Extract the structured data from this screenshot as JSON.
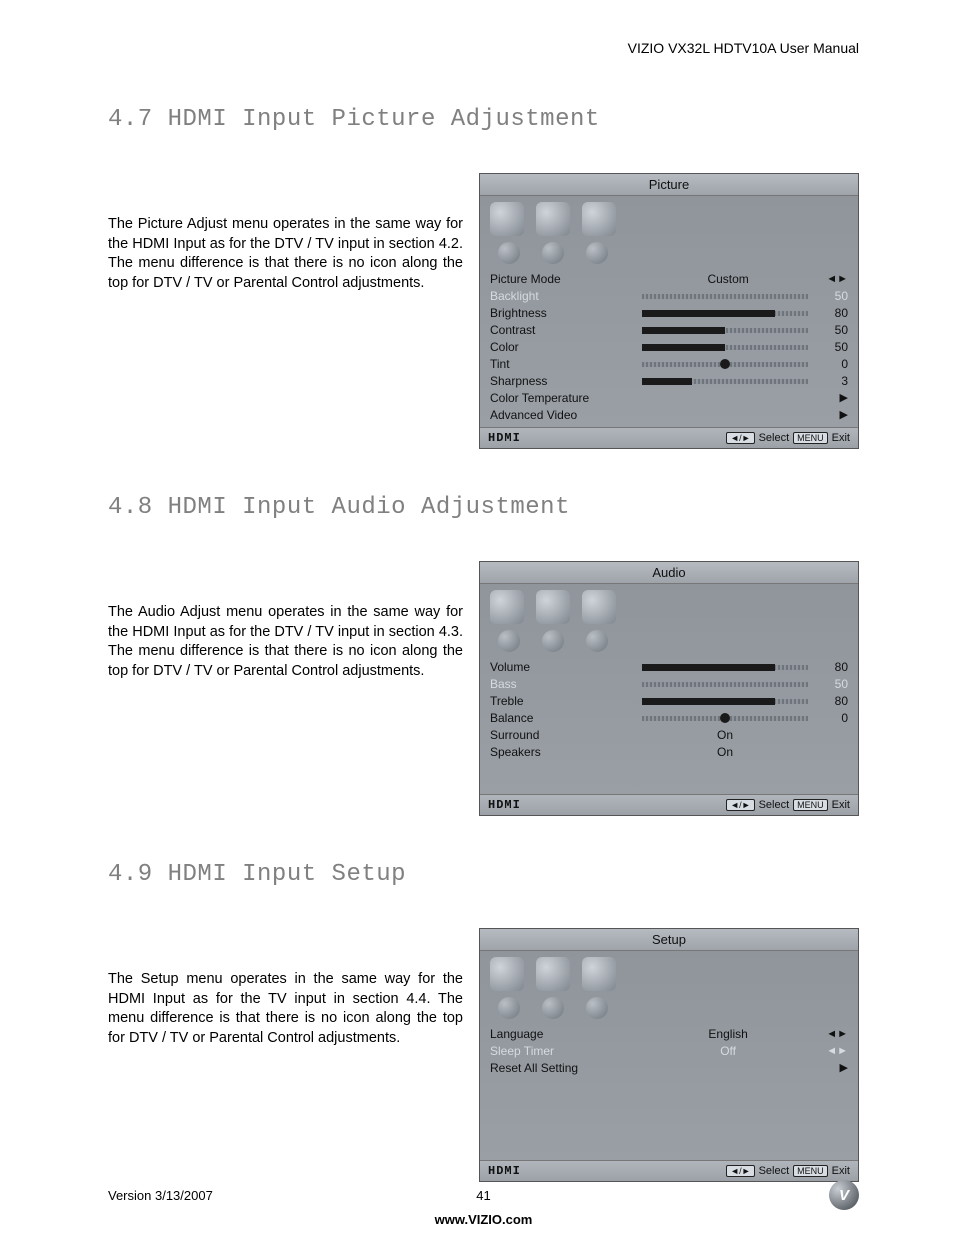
{
  "header": "VIZIO VX32L HDTV10A User Manual",
  "sections": {
    "s47": {
      "title": "4.7 HDMI Input Picture Adjustment",
      "text": "The Picture Adjust menu operates in the same way for the HDMI Input as for the DTV / TV input in section 4.2.  The menu difference is that there is no icon along the top for DTV / TV or Parental Control adjustments.",
      "menu": {
        "title": "Picture",
        "footer_input": "HDMI",
        "footer_select": "Select",
        "footer_exit": "Exit",
        "rows": {
          "mode_label": "Picture Mode",
          "mode_value": "Custom",
          "backlight_label": "Backlight",
          "backlight_value": "50",
          "brightness_label": "Brightness",
          "brightness_value": "80",
          "contrast_label": "Contrast",
          "contrast_value": "50",
          "color_label": "Color",
          "color_value": "50",
          "tint_label": "Tint",
          "tint_value": "0",
          "sharpness_label": "Sharpness",
          "sharpness_value": "3",
          "colortemp_label": "Color Temperature",
          "advanced_label": "Advanced Video"
        }
      }
    },
    "s48": {
      "title": "4.8 HDMI Input Audio Adjustment",
      "text": "The Audio Adjust menu operates in the same way for the HDMI Input as for the DTV / TV input in section 4.3.  The menu difference is that there is no icon along the top for DTV / TV or Parental Control adjustments.",
      "menu": {
        "title": "Audio",
        "footer_input": "HDMI",
        "footer_select": "Select",
        "footer_exit": "Exit",
        "rows": {
          "volume_label": "Volume",
          "volume_value": "80",
          "bass_label": "Bass",
          "bass_value": "50",
          "treble_label": "Treble",
          "treble_value": "80",
          "balance_label": "Balance",
          "balance_value": "0",
          "surround_label": "Surround",
          "surround_value": "On",
          "speakers_label": "Speakers",
          "speakers_value": "On"
        }
      }
    },
    "s49": {
      "title": "4.9 HDMI Input Setup",
      "text": "The Setup menu operates in the same way for the HDMI Input as for the TV input in section 4.4.  The menu difference is that there is no icon along the top for DTV / TV or Parental Control adjustments.",
      "menu": {
        "title": "Setup",
        "footer_input": "HDMI",
        "footer_select": "Select",
        "footer_exit": "Exit",
        "rows": {
          "language_label": "Language",
          "language_value": "English",
          "sleep_label": "Sleep Timer",
          "sleep_value": "Off",
          "reset_label": "Reset All Setting"
        }
      }
    }
  },
  "footer": {
    "version": "Version 3/13/2007",
    "page_number": "41",
    "url": "www.VIZIO.com",
    "logo_letter": "V"
  },
  "keys": {
    "arrows": "◄/►",
    "menu": "MENU"
  }
}
